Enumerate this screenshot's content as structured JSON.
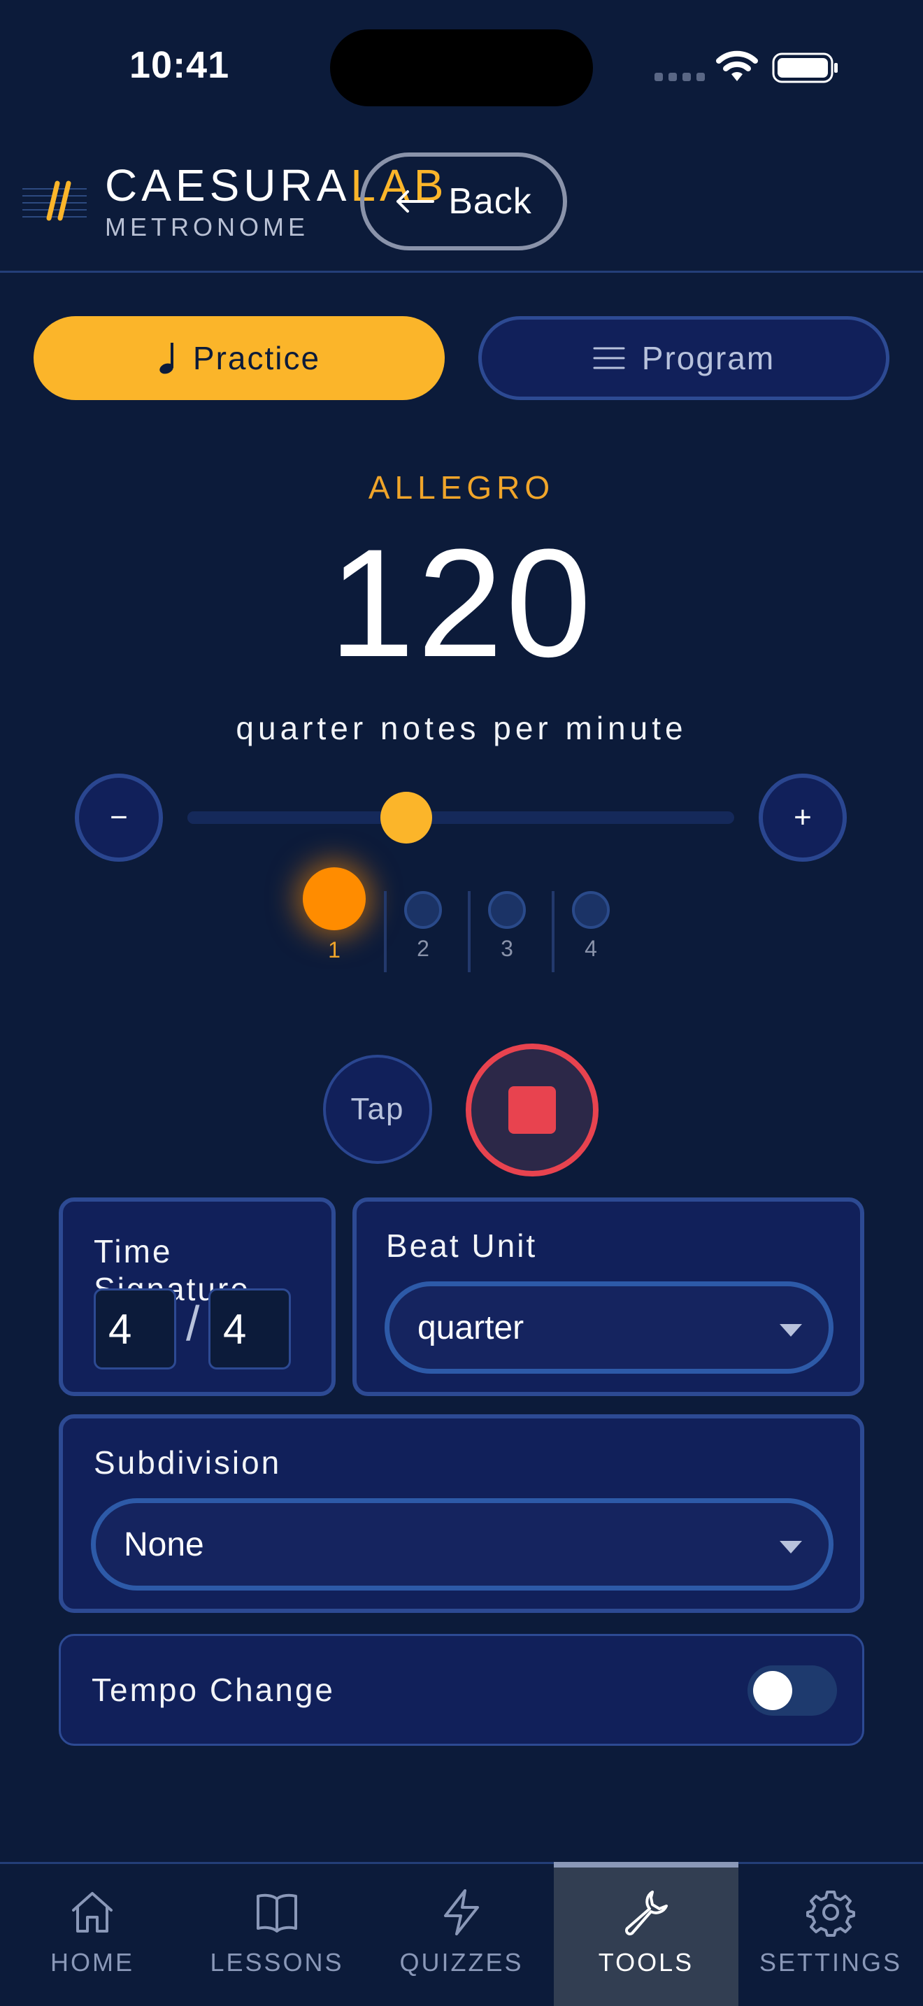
{
  "status_bar": {
    "time": "10:41"
  },
  "header": {
    "brand_name_main": "CAESURA",
    "brand_name_accent": "LAB",
    "brand_subtitle": "METRONOME",
    "back_label": "Back",
    "back_icon": "arrow-left-icon",
    "logo_icon": "caesura-logo-icon"
  },
  "mode_tabs": [
    {
      "label": "Practice",
      "icon": "quarter-note-icon",
      "active": true
    },
    {
      "label": "Program",
      "icon": "menu-lines-icon",
      "active": false
    }
  ],
  "tempo": {
    "marking": "ALLEGRO",
    "bpm": "120",
    "unit_text": "quarter notes per minute",
    "slider_fraction": 0.4
  },
  "controls": {
    "minus": "−",
    "plus": "+",
    "tap_label": "Tap"
  },
  "beats": [
    {
      "label": "1",
      "active": true
    },
    {
      "label": "2",
      "active": false
    },
    {
      "label": "3",
      "active": false
    },
    {
      "label": "4",
      "active": false
    }
  ],
  "time_signature": {
    "title": "Time Signature",
    "numerator": "4",
    "separator": "/",
    "denominator": "4"
  },
  "beat_unit": {
    "title": "Beat Unit",
    "value": "quarter"
  },
  "subdivision": {
    "title": "Subdivision",
    "value": "None"
  },
  "tempo_change": {
    "title": "Tempo Change",
    "enabled": false
  },
  "bottom_nav": [
    {
      "label": "HOME",
      "icon": "home-icon",
      "active": false
    },
    {
      "label": "LESSONS",
      "icon": "book-icon",
      "active": false
    },
    {
      "label": "QUIZZES",
      "icon": "lightning-icon",
      "active": false
    },
    {
      "label": "TOOLS",
      "icon": "wrench-icon",
      "active": true
    },
    {
      "label": "SETTINGS",
      "icon": "gear-icon",
      "active": false
    }
  ],
  "colors": {
    "background": "#0c1b3a",
    "accent": "#fbb52a",
    "beat_active": "#ff8c00",
    "stop": "#e8434f",
    "card": "#11205a",
    "card_border": "#2d4a93"
  }
}
